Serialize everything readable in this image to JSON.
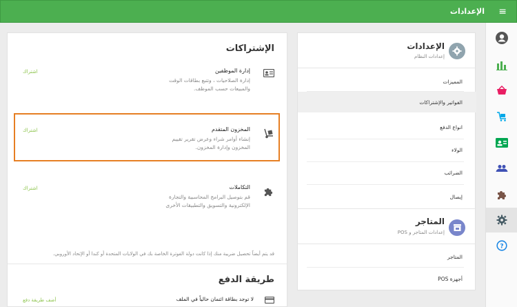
{
  "topbar": {
    "title": "الإعدادات",
    "menu_glyph": "≡"
  },
  "sidebar": {
    "items": [
      {
        "name": "profile",
        "color": "#555555"
      },
      {
        "name": "reports",
        "color": "#4caf50"
      },
      {
        "name": "sales",
        "color": "#e91e63"
      },
      {
        "name": "purchases",
        "color": "#00a8e8"
      },
      {
        "name": "contacts",
        "color": "#00a651"
      },
      {
        "name": "users",
        "color": "#3f51b5"
      },
      {
        "name": "apps",
        "color": "#795548"
      },
      {
        "name": "settings",
        "color": "#455a64",
        "active": true
      },
      {
        "name": "help",
        "color": "#1e88e5"
      }
    ]
  },
  "subscriptions": {
    "title": "الإشتراكات",
    "items": [
      {
        "name": "إدارة الموظفين",
        "desc_line1": "إدارة الصلاحيات ، وتتبع بطاقات الوقت",
        "desc_line2": "والمبيعات حسب الموظف.",
        "action": "اشتراك",
        "icon": "id-card-icon"
      },
      {
        "name": "المخزون المتقدم",
        "desc_line1": "إنشاء أوامر شراء وعرض تقرير تقييم",
        "desc_line2": "المخزون وإدارة المخزون.",
        "action": "اشتراك",
        "icon": "dolly-icon"
      },
      {
        "name": "التكاملات",
        "desc_line1": "قم بتوصيل البرامج المحاسبية والتجارة",
        "desc_line2": "الإلكترونية والتسويق والتطبيقات الأخرى",
        "action": "اشتراك",
        "icon": "puzzle-icon"
      }
    ],
    "tax_note": "قد يتم أيضاً تحصيل ضريبة منك إذا كانت دولة الفوترة الخاصة بك في الولايات المتحدة أو كندا أو الإتحاد الأوروبي."
  },
  "payment": {
    "title": "طريقة الدفع",
    "no_card": "لا توجد بطاقة ائتمان حالياً في الملف",
    "add_link": "أضف طريقة دفع"
  },
  "settings_menu": {
    "title": "الإعدادات",
    "subtitle": "إعدادات النظام",
    "items": [
      "المميزات",
      "الفواتير والإشتراكات",
      "انواع الدفع",
      "الولاء",
      "الضرائب",
      "إيصال"
    ],
    "selected_index": 1
  },
  "stores_menu": {
    "title": "المتاجر",
    "subtitle": "إعدادات المتاجر و POS",
    "items": [
      "المتاجر",
      "أجهزة POS"
    ]
  }
}
